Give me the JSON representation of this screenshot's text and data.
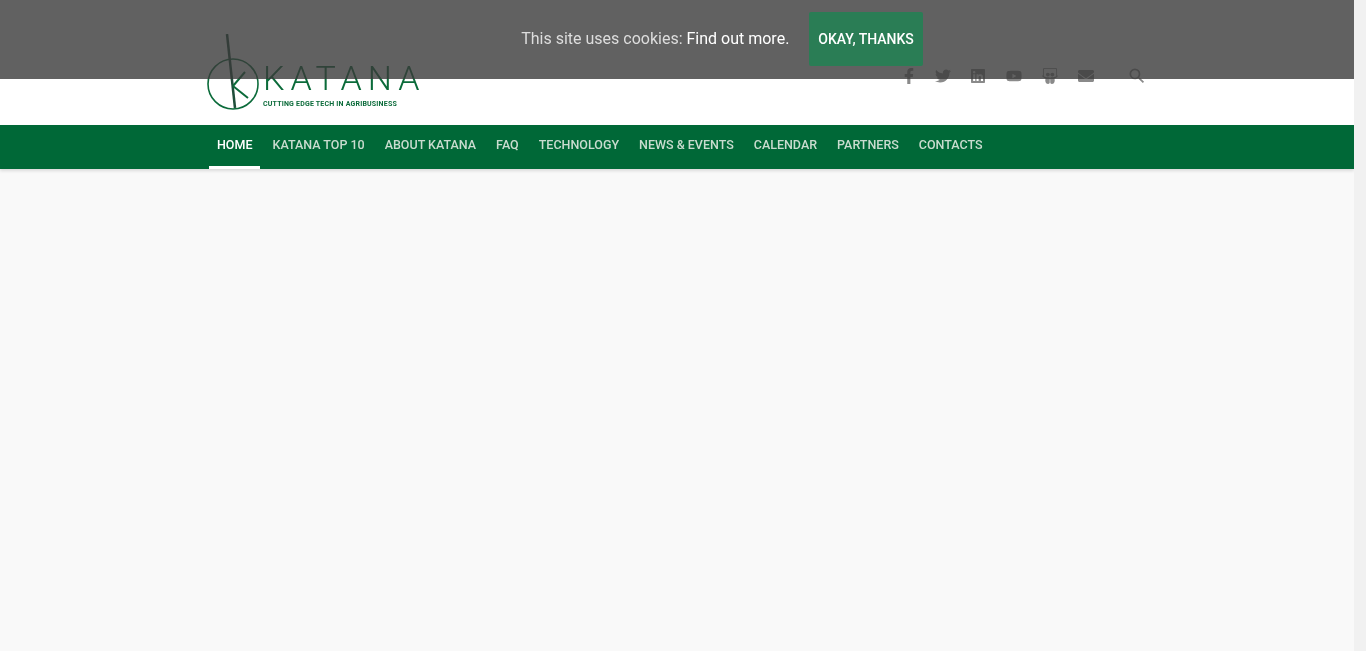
{
  "cookie_bar": {
    "message": "This site uses cookies:",
    "link": "Find out more.",
    "button": "OKAY, THANKS"
  },
  "logo": {
    "name": "KATANA",
    "tagline": "CUTTING EDGE TECH IN AGRIBUSINESS"
  },
  "nav": [
    {
      "label": "HOME",
      "selected": true
    },
    {
      "label": "KATANA TOP 10",
      "selected": false
    },
    {
      "label": "ABOUT KATANA",
      "selected": false
    },
    {
      "label": "FAQ",
      "selected": false
    },
    {
      "label": "TECHNOLOGY",
      "selected": false
    },
    {
      "label": "NEWS & EVENTS",
      "selected": false
    },
    {
      "label": "CALENDAR",
      "selected": false
    },
    {
      "label": "PARTNERS",
      "selected": false
    },
    {
      "label": "CONTACTS",
      "selected": false
    }
  ]
}
